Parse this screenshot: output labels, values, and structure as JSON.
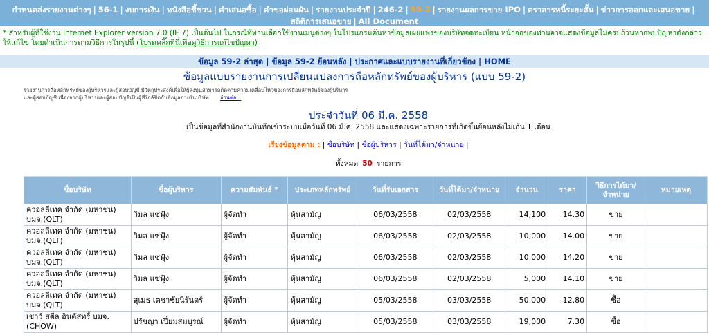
{
  "top_nav": {
    "items": [
      {
        "label": "กำหนดส่งรายงานต่างๆ"
      },
      {
        "label": "56-1"
      },
      {
        "label": "งบการเงิน"
      },
      {
        "label": "หนังสือชี้ชวน"
      },
      {
        "label": "คำเสนอซื้อ"
      },
      {
        "label": "คำขอผ่อนผัน"
      },
      {
        "label": "รายงานประจำปี"
      },
      {
        "label": "246-2"
      },
      {
        "label": "59-2",
        "active": true
      },
      {
        "label": "รายงานผลการขาย IPO"
      },
      {
        "label": "ตราสารหนี้ระยะสั้น"
      },
      {
        "label": "ข่าวการออกและเสนอขาย"
      }
    ],
    "row2": [
      {
        "label": "สถิติการเสนอขาย"
      },
      {
        "label": "All Document"
      }
    ]
  },
  "ie_note": {
    "text": "* สำหรับผู้ที่ใช้งาน Internet Explorer version 7.0 (IE 7) เป็นต้นไป ในกรณีที่ท่านเลือกใช้งานเมนูต่างๆ ในโปรแกรมค้นหาข้อมูลเผยแพร่ของบริษัทจดทะเบียน หน้าจอของท่านอาจแสดงข้อมูลไม่ครบถ้วนหากพบปัญหาดังกล่าวให้แก้ไข โดยดำเนินการตามวิธีการในรูปนี้ ",
    "link": "(โปรดคลิ๊กที่นี่เพื่อดูวิธีการแก้ไขปัญหา)"
  },
  "sub_nav": {
    "items": [
      {
        "label": "ข้อมูล 59-2 ล่าสุด"
      },
      {
        "label": "ข้อมูล 59-2 ย้อนหลัง"
      },
      {
        "label": "ประกาศและแบบรายงานที่เกี่ยวข้อง"
      },
      {
        "label": "HOME"
      }
    ]
  },
  "page_title": "ข้อมูลแบบรายงานการเปลี่ยนแปลงการถือหลักทรัพย์ของผู้บริหาร (แบบ 59-2)",
  "description": {
    "text": "รายงานการถือหลักทรัพย์ของผู้บริหารและผู้สอบบัญชี มีวัตถุประสงค์เพื่อให้ผู้ลงทุนสามารถติดตามความเคลื่อนไหวของการถือหลักทรัพย์ของผู้บริหารและผู้สอบบัญชี เนื่องจากผู้บริหารและผู้สอบบัญชีเป็นผู้ที่ใกล้ชิดกับข้อมูลภายในบริษัท",
    "more": "อ่านต่อ..."
  },
  "date_title": "ประจำวันที่ 06 มี.ค. 2558",
  "date_sub": "เป็นข้อมูลที่สำนักงานบันทึกเข้าระบบเมื่อวันที่ 06 มี.ค. 2558 และแสดงเฉพาะรายการที่เกิดขึ้นย้อนหลังไม่เกิน 1 เดือน",
  "sort_bar": {
    "label": "เรียงข้อมูลตาม :",
    "options": [
      "ชื่อบริษัท",
      "ชื่อผู้บริหาร",
      "วันที่ได้มา/จำหน่าย"
    ]
  },
  "total": {
    "prefix": "ทั้งหมด",
    "count": "50",
    "suffix": "รายการ"
  },
  "table": {
    "headers": [
      "ชื่อบริษัท",
      "ชื่อผู้บริหาร",
      "ความสัมพันธ์ *",
      "ประเภทหลักทรัพย์",
      "วันที่รับเอกสาร",
      "วันที่ได้มา/จำหน่าย",
      "จำนวน",
      "ราคา",
      "วิธีการได้มา/จำหน่าย",
      "หมายเหตุ"
    ],
    "rows": [
      {
        "company": "ควอลลีเทค จำกัด (มหาชน) บมจ.(QLT)",
        "executive": "วิมล แซ่ฟุ้ง",
        "relation": "ผู้จัดทำ",
        "security": "หุ้นสามัญ",
        "received": "06/03/2558",
        "transaction": "02/03/2558",
        "amount": "14,100",
        "price": "14.30",
        "method": "ขาย",
        "remark": ""
      },
      {
        "company": "ควอลลีเทค จำกัด (มหาชน) บมจ.(QLT)",
        "executive": "วิมล แซ่ฟุ้ง",
        "relation": "ผู้จัดทำ",
        "security": "หุ้นสามัญ",
        "received": "06/03/2558",
        "transaction": "02/03/2558",
        "amount": "10,000",
        "price": "14.00",
        "method": "ขาย",
        "remark": ""
      },
      {
        "company": "ควอลลีเทค จำกัด (มหาชน) บมจ.(QLT)",
        "executive": "วิมล แซ่ฟุ้ง",
        "relation": "ผู้จัดทำ",
        "security": "หุ้นสามัญ",
        "received": "06/03/2558",
        "transaction": "02/03/2558",
        "amount": "10,000",
        "price": "14.20",
        "method": "ขาย",
        "remark": ""
      },
      {
        "company": "ควอลลีเทค จำกัด (มหาชน) บมจ.(QLT)",
        "executive": "วิมล แซ่ฟุ้ง",
        "relation": "ผู้จัดทำ",
        "security": "หุ้นสามัญ",
        "received": "06/03/2558",
        "transaction": "02/03/2558",
        "amount": "5,000",
        "price": "14.10",
        "method": "ขาย",
        "remark": ""
      },
      {
        "company": "ควอลลีเทค จำกัด (มหาชน) บมจ.(QLT)",
        "executive": "สุเมธ เตชาชัยนิรันดร์",
        "relation": "ผู้จัดทำ",
        "security": "หุ้นสามัญ",
        "received": "05/03/2558",
        "transaction": "03/03/2558",
        "amount": "50,000",
        "price": "12.80",
        "method": "ซื้อ",
        "remark": ""
      },
      {
        "company": "เชาว์ สตีล อินดัสทรี้ บมจ. (CHOW)",
        "executive": "ปรัชญา เปี่ยมสมบูรณ์",
        "relation": "ผู้จัดทำ",
        "security": "หุ้นสามัญ",
        "received": "05/03/2558",
        "transaction": "03/03/2558",
        "amount": "19,000",
        "price": "7.30",
        "method": "ซื้อ",
        "remark": ""
      }
    ]
  },
  "colors": {
    "nav_bg": "#7bb0d9",
    "nav_active": "#f7a530",
    "subnav_bg": "#d6e6f5",
    "title_blue": "#003399",
    "table_header_bg": "#8fb7da",
    "note_green": "#008000"
  }
}
